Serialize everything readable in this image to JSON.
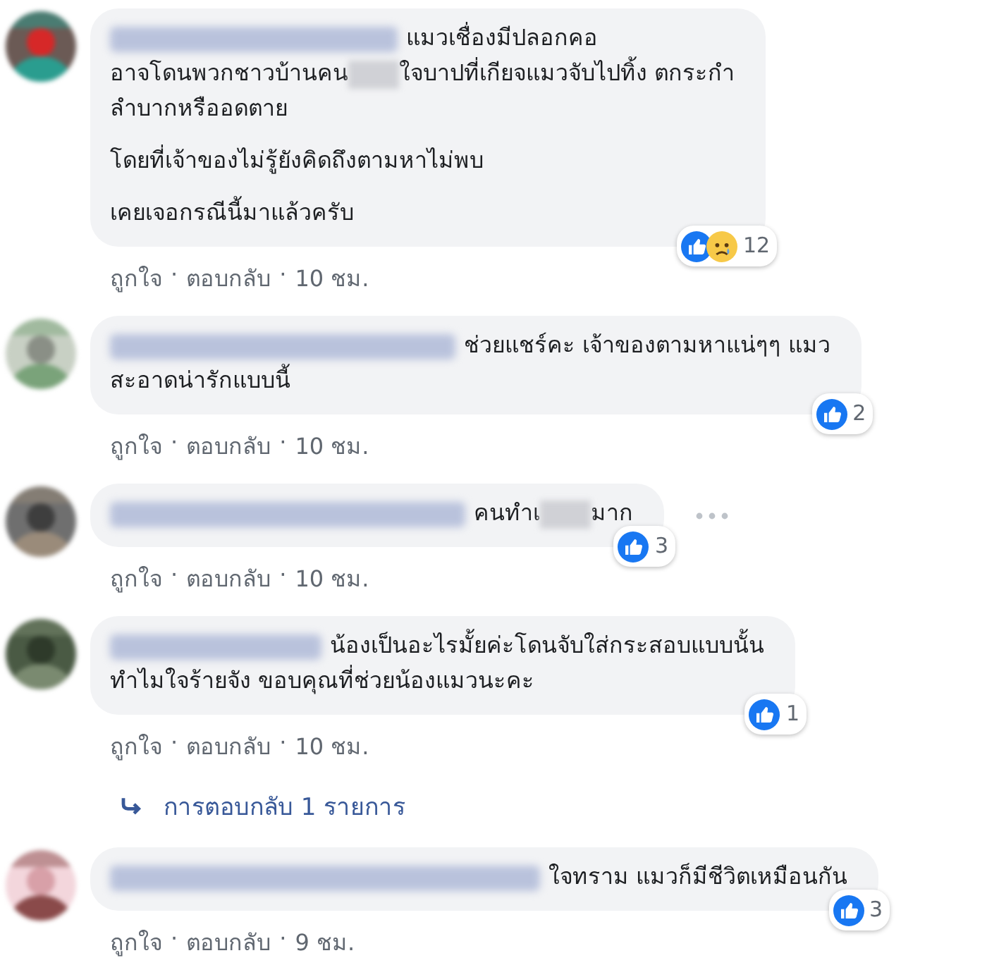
{
  "separator": "·",
  "comments": [
    {
      "paragraphs": [
        [
          [
            {
              "kind": "text",
              "text": "แมวเชื่องมีปลอกคอ"
            }
          ],
          [
            {
              "kind": "text",
              "text": "อาจโดนพวกชาวบ้านคน"
            },
            {
              "kind": "blur"
            },
            {
              "kind": "text",
              "text": "ใจบาปที่เกียจแมวจับไปทิ้ง ตกระกำ"
            }
          ],
          [
            {
              "kind": "text",
              "text": "ลำบากหรืออดตาย"
            }
          ]
        ],
        [
          [
            {
              "kind": "text",
              "text": "โดยที่เจ้าของไม่รู้ยังคิดถึงตามหาไม่พบ"
            }
          ]
        ],
        [
          [
            {
              "kind": "text",
              "text": "เคยเจอกรณีนี้มาแล้วครับ"
            }
          ]
        ]
      ],
      "reactions": [
        {
          "kind": "like"
        },
        {
          "kind": "sad"
        }
      ],
      "count": "12",
      "actions": [
        "ถูกใจ",
        "ตอบกลับ"
      ],
      "time": "10 ชม.",
      "options_icon": false
    },
    {
      "paragraphs": [
        [
          [
            {
              "kind": "text",
              "text": "ช่วยแชร์คะ เจ้าของตามหาแน่ๆๆ แมว"
            }
          ],
          [
            {
              "kind": "text",
              "text": "สะอาดน่ารักแบบนี้"
            }
          ]
        ]
      ],
      "reactions": [
        {
          "kind": "like"
        }
      ],
      "count": "2",
      "actions": [
        "ถูกใจ",
        "ตอบกลับ"
      ],
      "time": "10 ชม.",
      "options_icon": false
    },
    {
      "paragraphs": [
        [
          [
            {
              "kind": "text",
              "text": "คนทำเ"
            },
            {
              "kind": "blur"
            },
            {
              "kind": "text",
              "text": "มาก"
            }
          ]
        ]
      ],
      "reactions": [
        {
          "kind": "like"
        }
      ],
      "count": "3",
      "actions": [
        "ถูกใจ",
        "ตอบกลับ"
      ],
      "time": "10 ชม.",
      "options_icon": true
    },
    {
      "paragraphs": [
        [
          [
            {
              "kind": "text",
              "text": "น้องเป็นอะไรมั้ยค่ะโดนจับใส่กระสอบแบบนั้น"
            }
          ],
          [
            {
              "kind": "text",
              "text": "ทำไมใจร้ายจัง ขอบคุณที่ช่วยน้องแมวนะคะ"
            }
          ]
        ]
      ],
      "reactions": [
        {
          "kind": "like"
        }
      ],
      "count": "1",
      "actions": [
        "ถูกใจ",
        "ตอบกลับ"
      ],
      "time": "10 ชม.",
      "options_icon": false,
      "replies_link": "การตอบกลับ 1 รายการ"
    },
    {
      "paragraphs": [
        [
          [
            {
              "kind": "text",
              "text": "ใจทราม แมวก็มีชีวิตเหมือนกัน"
            }
          ]
        ]
      ],
      "reactions": [
        {
          "kind": "like"
        }
      ],
      "count": "3",
      "actions": [
        "ถูกใจ",
        "ตอบกลับ"
      ],
      "time": "9 ชม.",
      "options_icon": false
    }
  ]
}
